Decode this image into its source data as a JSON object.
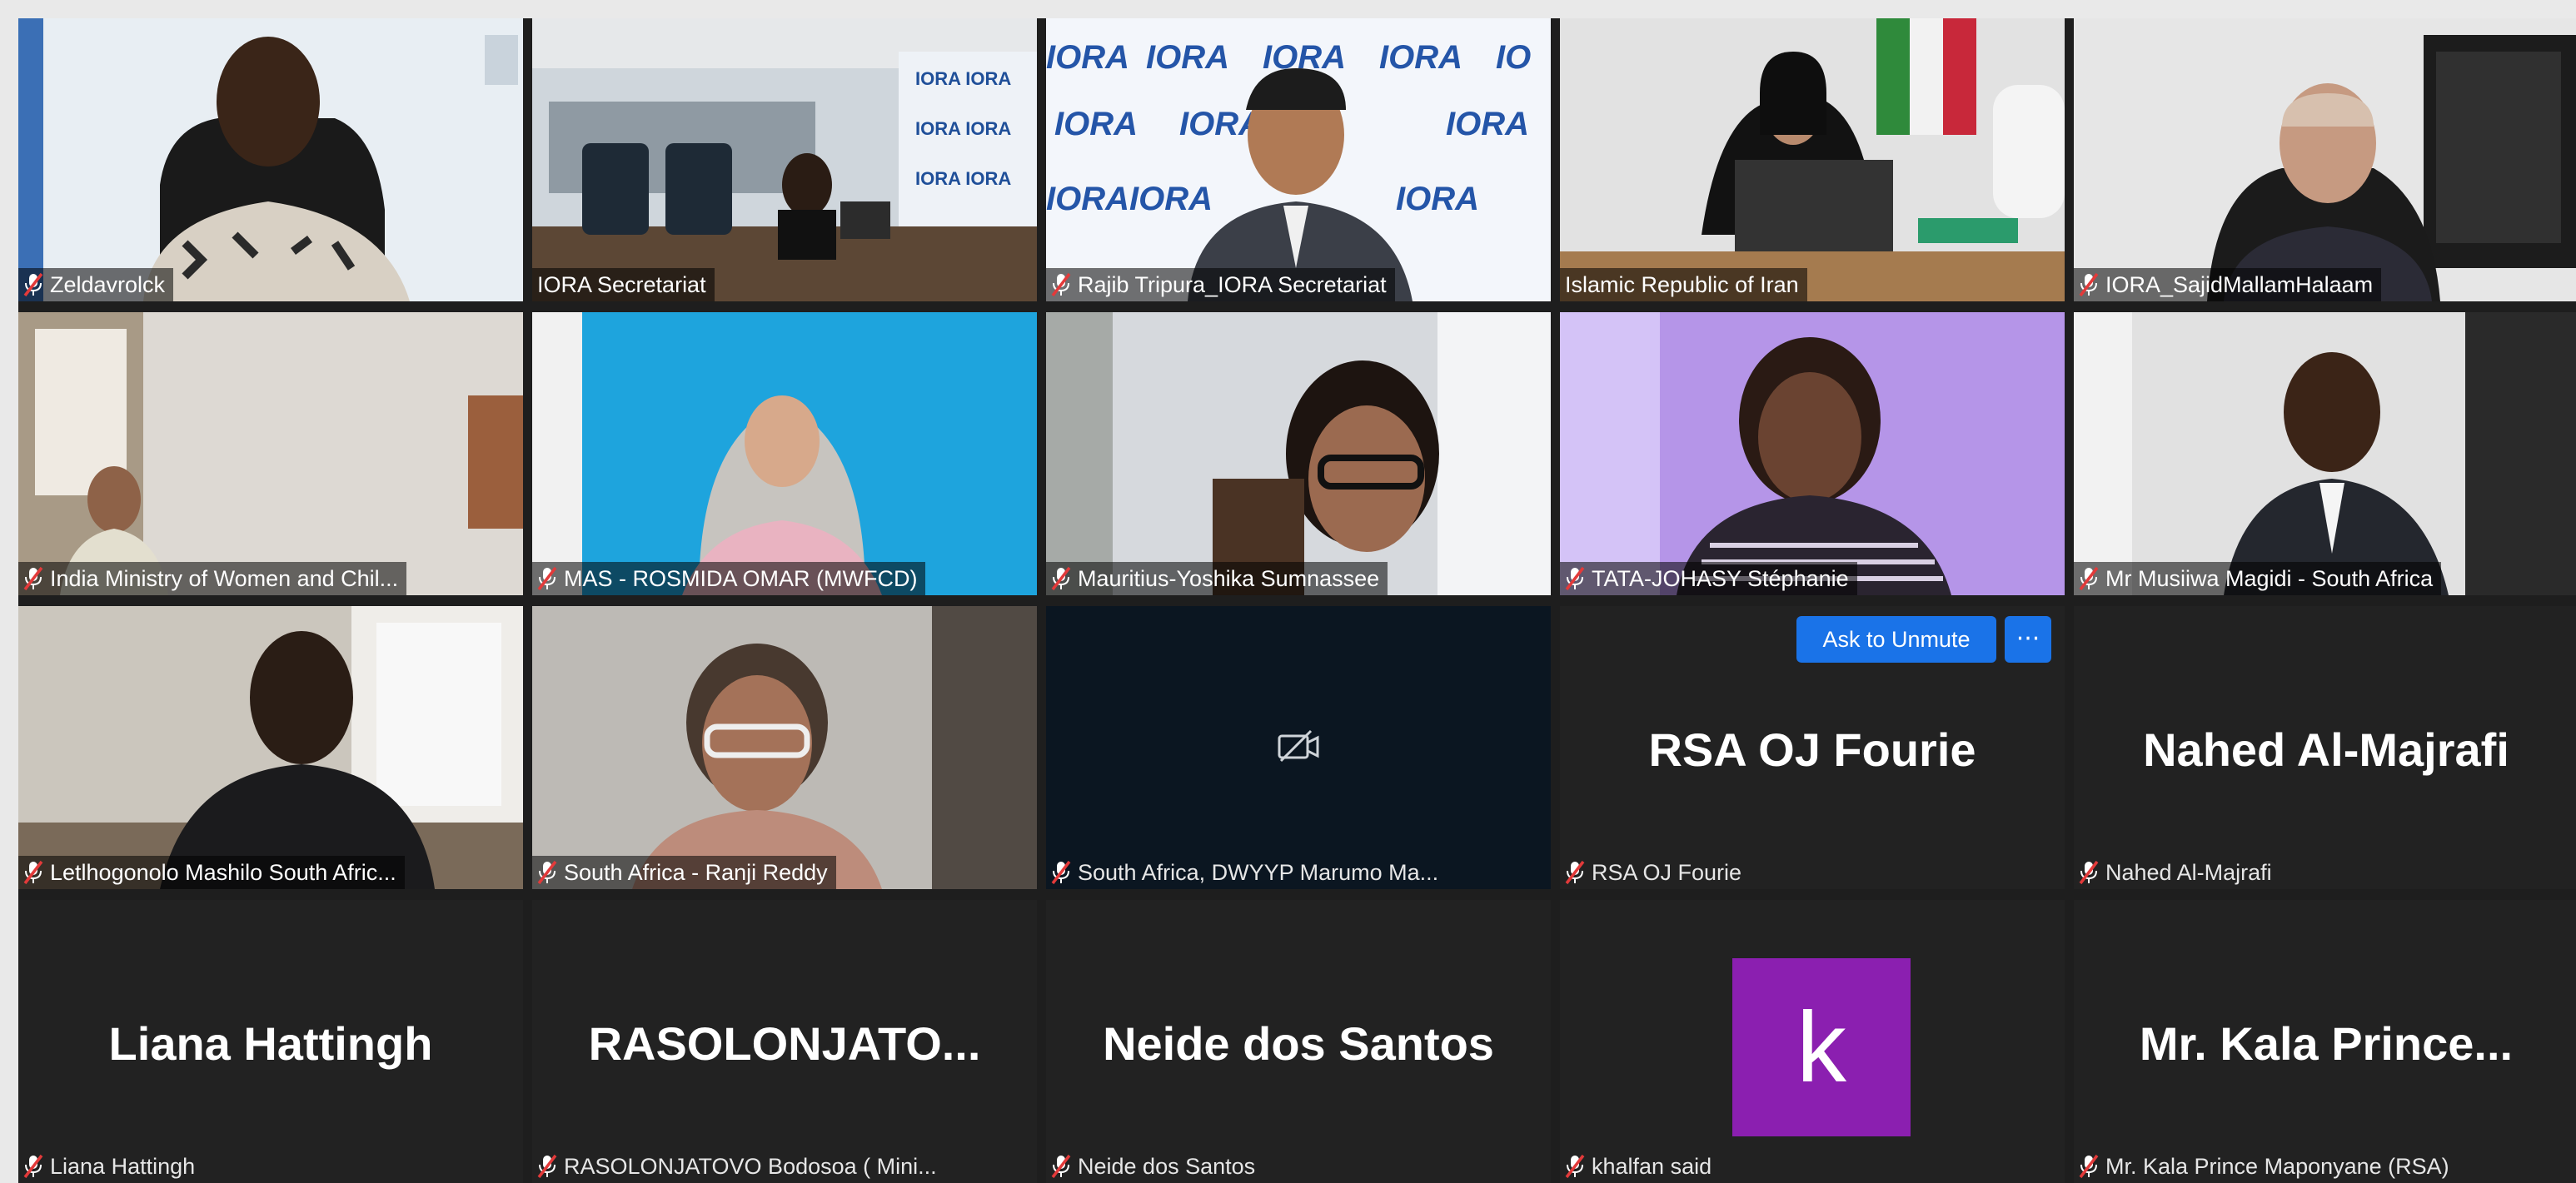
{
  "participants": [
    {
      "display_name": "Zeldavrolck",
      "type": "video"
    },
    {
      "display_name": "IORA Secretariat",
      "type": "video"
    },
    {
      "display_name": "Rajib Tripura_IORA Secretariat",
      "type": "video"
    },
    {
      "display_name": "Islamic Republic of Iran",
      "type": "video",
      "active_speaker": true
    },
    {
      "display_name": "IORA_SajidMallamHalaam",
      "type": "video"
    },
    {
      "display_name": "India Ministry of Women and Chil...",
      "type": "video"
    },
    {
      "display_name": "MAS - ROSMIDA OMAR (MWFCD)",
      "type": "video"
    },
    {
      "display_name": "Mauritius-Yoshika Sumnassee",
      "type": "video"
    },
    {
      "display_name": "TATA-JOHASY Stéphanie",
      "type": "video"
    },
    {
      "display_name": "Mr Musiiwa Magidi - South Africa",
      "type": "video"
    },
    {
      "display_name": "Letlhogonolo Mashilo South Afric...",
      "type": "video"
    },
    {
      "display_name": "South Africa - Ranji Reddy",
      "type": "video"
    },
    {
      "display_name": "South Africa, DWYYP Marumo Ma...",
      "type": "camera-off"
    },
    {
      "display_name": "RSA OJ Fourie",
      "type": "name",
      "big_name": "RSA OJ Fourie",
      "ask_to_unmute": "Ask to Unmute",
      "more_label": "···"
    },
    {
      "display_name": "Nahed Al-Majrafi",
      "type": "name",
      "big_name": "Nahed Al-Majrafi"
    },
    {
      "display_name": "Liana Hattingh",
      "type": "name",
      "big_name": "Liana Hattingh"
    },
    {
      "display_name": "RASOLONJATOVO Bodosoa ( Mini...",
      "type": "name",
      "big_name": "RASOLONJATO..."
    },
    {
      "display_name": "Neide dos Santos",
      "type": "name",
      "big_name": "Neide dos Santos"
    },
    {
      "display_name": "khalfan said",
      "type": "avatar",
      "avatar_letter": "k"
    },
    {
      "display_name": "Mr. Kala Prince Maponyane (RSA)",
      "type": "name",
      "big_name": "Mr. Kala Prince..."
    }
  ],
  "colors": {
    "active_speaker_border": "#c5e03b",
    "ask_to_unmute_button": "#1a73e8",
    "avatar_bg": "#8b1fb0",
    "muted_mic": "#e33a3a"
  }
}
